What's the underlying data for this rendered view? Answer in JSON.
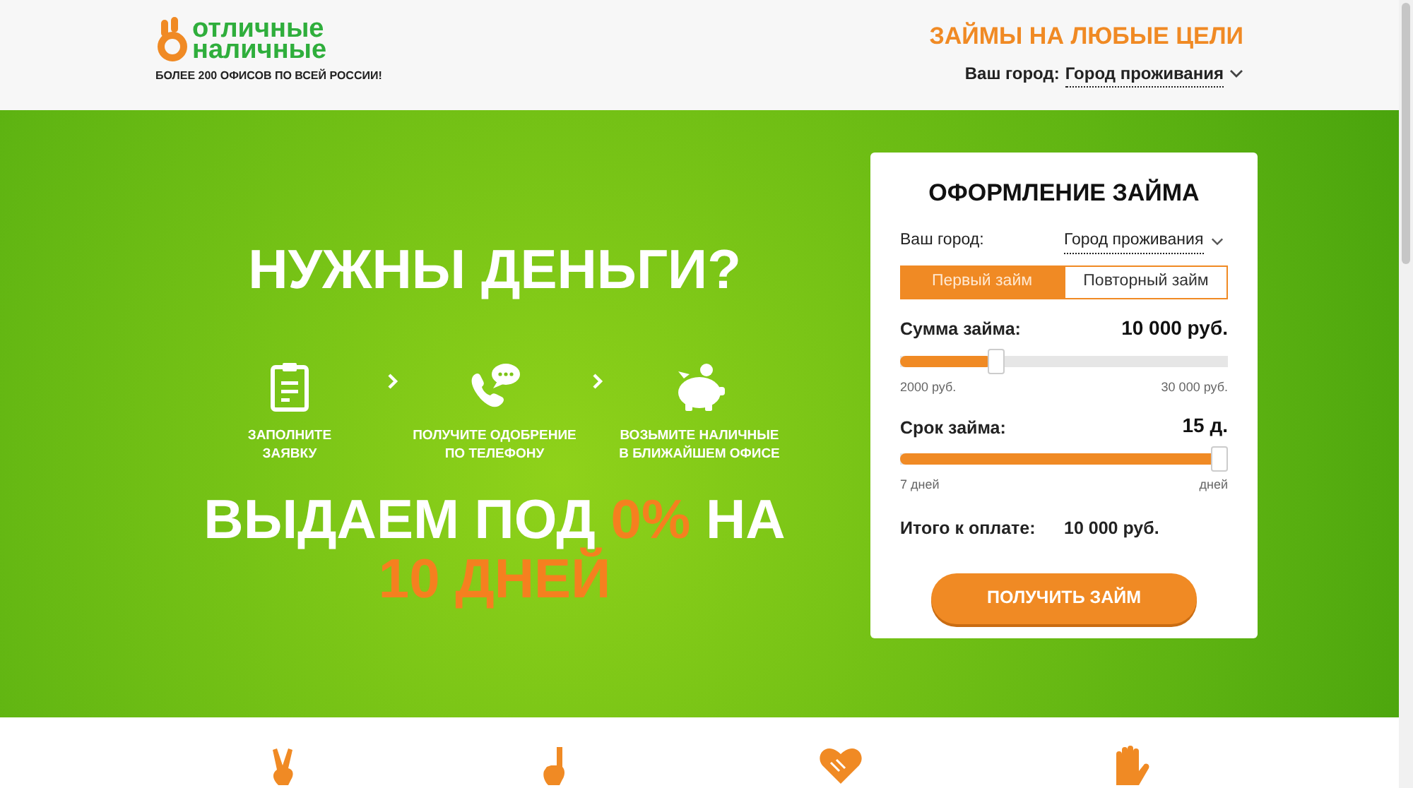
{
  "header": {
    "logo_line1": "отличные",
    "logo_line2": "наличные",
    "tagline": "БОЛЕЕ 200 ОФИСОВ ПО ВСЕЙ РОССИИ!",
    "slogan": "ЗАЙМЫ НА ЛЮБЫЕ ЦЕЛИ",
    "city_label": "Ваш город:",
    "city_value": "Город проживания"
  },
  "hero": {
    "title": "НУЖНЫ ДЕНЬГИ?",
    "steps": [
      {
        "kind": "form",
        "text": "ЗАПОЛНИТЕ\nЗАЯВКУ"
      },
      {
        "kind": "phone",
        "text": "ПОЛУЧИТЕ ОДОБРЕНИЕ\nПО ТЕЛЕФОНУ"
      },
      {
        "kind": "piggy",
        "text": "ВОЗЬМИТЕ НАЛИЧНЫЕ\nВ БЛИЖАЙШЕМ ОФИСЕ"
      }
    ],
    "promo_lines": [
      [
        {
          "text": "ВЫДАЕМ ПОД ",
          "accent": false
        },
        {
          "text": "0%",
          "accent": true
        },
        {
          "text": " НА",
          "accent": false
        }
      ],
      [
        {
          "text": "10 ДНЕЙ",
          "accent": true
        }
      ]
    ]
  },
  "form": {
    "title": "ОФОРМЛЕНИЕ ЗАЙМА",
    "city_label": "Ваш город:",
    "city_value": "Город проживания",
    "tabs": [
      {
        "label": "Первый займ",
        "selected": true
      },
      {
        "label": "Повторный займ",
        "selected": false
      }
    ],
    "sliders": [
      {
        "label": "Сумма займа:",
        "value": "10 000 руб.",
        "level": 0.28,
        "min": "2000 руб.",
        "max": "30 000 руб."
      },
      {
        "label": "Срок займа:",
        "value": "15 д.",
        "level": 1,
        "min": "7 дней",
        "max": "дней"
      }
    ],
    "total_label": "Итого к оплате:",
    "total_value": "10 000 руб.",
    "submit": "ПОЛУЧИТЬ ЗАЙМ"
  },
  "features": [
    {
      "kind": "victory"
    },
    {
      "kind": "finger"
    },
    {
      "kind": "handshake"
    },
    {
      "kind": "palm"
    }
  ]
}
